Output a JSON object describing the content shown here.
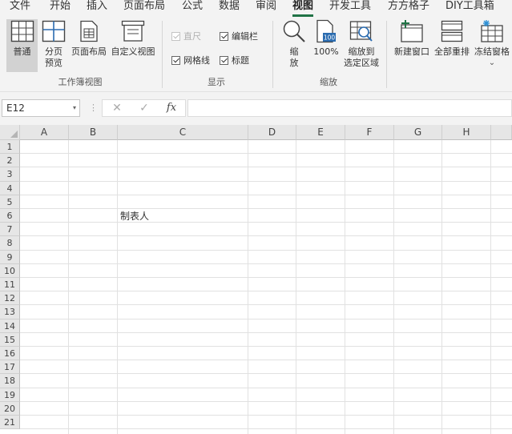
{
  "menu": {
    "tabs": [
      "文件",
      "开始",
      "插入",
      "页面布局",
      "公式",
      "数据",
      "审阅",
      "视图",
      "开发工具",
      "方方格子",
      "DIY工具箱"
    ],
    "active_tab": "视图"
  },
  "ribbon": {
    "workbook_views": {
      "group_label": "工作簿视图",
      "normal": "普通",
      "page_break_line1": "分页",
      "page_break_line2": "预览",
      "page_layout": "页面布局",
      "custom_views": "自定义视图"
    },
    "show": {
      "group_label": "显示",
      "ruler": "直尺",
      "formula_bar": "编辑栏",
      "gridlines": "网格线",
      "headings": "标题"
    },
    "zoom": {
      "group_label": "缩放",
      "zoom_line1": "缩",
      "zoom_line2": "放",
      "hundred": "100%",
      "hundred_icon_text": "100",
      "zoom_sel_line1": "缩放到",
      "zoom_sel_line2": "选定区域"
    },
    "window": {
      "new_window": "新建窗口",
      "arrange_all": "全部重排",
      "freeze_panes": "冻结窗格",
      "freeze_caret": "⌄"
    }
  },
  "formula_bar": {
    "name_box": "E12",
    "name_caret": "▾",
    "dots": "⋮",
    "cancel": "✕",
    "confirm": "✓",
    "fx": "fx",
    "formula": ""
  },
  "sheet": {
    "columns": [
      "A",
      "B",
      "C",
      "D",
      "E",
      "F",
      "G",
      "H"
    ],
    "rows": [
      "1",
      "2",
      "3",
      "4",
      "5",
      "6",
      "7",
      "8",
      "9",
      "10",
      "11",
      "12",
      "13",
      "14",
      "15",
      "16",
      "17",
      "18",
      "19",
      "20",
      "21"
    ],
    "cells": {
      "C6": "制表人"
    }
  },
  "colors": {
    "accent": "#217346",
    "ribbon_bg": "#f3f3f3",
    "header_bg": "#e6e6e6",
    "gridline": "#e1e1e1"
  }
}
